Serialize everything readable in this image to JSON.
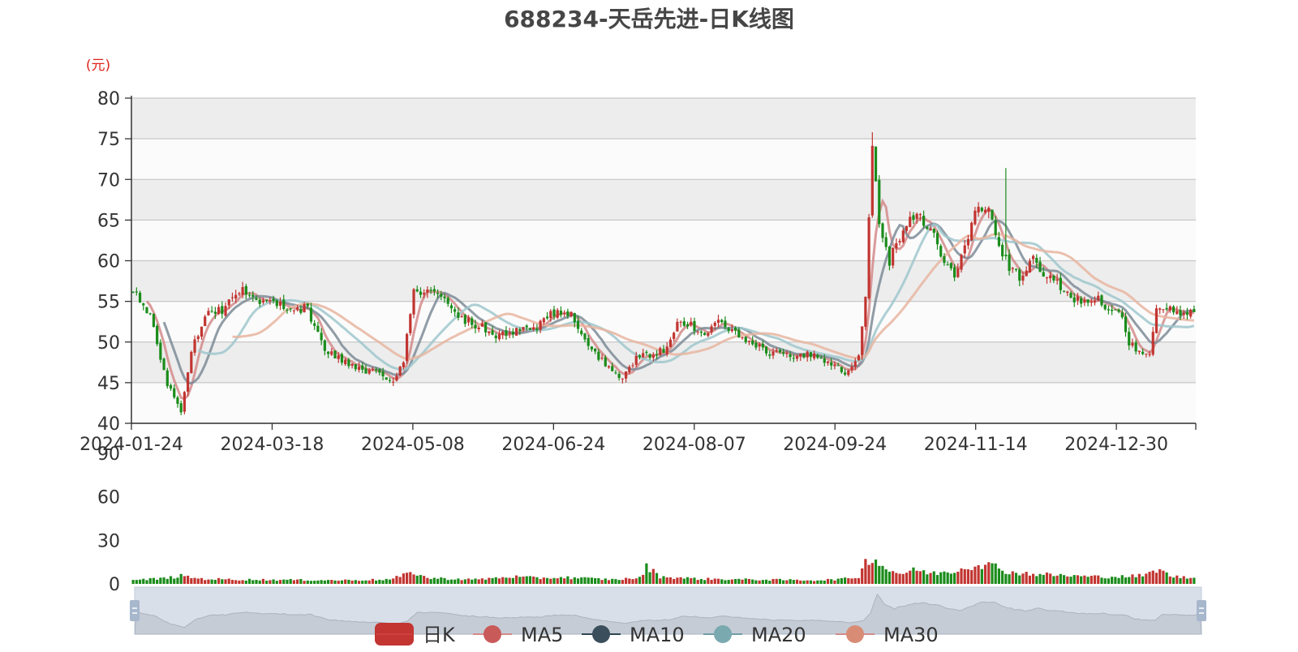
{
  "chart_data": {
    "type": "candlestick",
    "title": "688234-天岳先进-日K线图",
    "unit_label": "(元)",
    "y_ticks": [
      "40",
      "45",
      "50",
      "55",
      "60",
      "65",
      "70",
      "75",
      "80"
    ],
    "ylim": [
      40,
      80
    ],
    "x_tick_labels": [
      "2024-01-24",
      "2024-03-18",
      "2024-05-08",
      "2024-06-24",
      "2024-08-07",
      "2024-09-24",
      "2024-11-14",
      "2024-12-30"
    ],
    "volume_y_ticks": [
      "0",
      "30",
      "60",
      "90"
    ],
    "volume_ylim": [
      0,
      90
    ],
    "grid": true,
    "legend_position": "bottom",
    "legend": [
      "日K",
      "MA5",
      "MA10",
      "MA20",
      "MA30"
    ],
    "colors": {
      "up": "#c23531",
      "down": "#1b8c1b",
      "ma5": "#d48a8a",
      "ma10": "#7c8b96",
      "ma20": "#9fc7cc",
      "ma30": "#e8b5a0",
      "band_dark": "#ededed",
      "band_light": "#fbfbfb",
      "zoom_bg": "#d9dfe9",
      "zoom_handle": "#a7b7cc",
      "unit": "#e0241c"
    },
    "close_keypoints": [
      [
        0,
        56.5
      ],
      [
        5,
        53
      ],
      [
        10,
        45
      ],
      [
        14,
        41.5
      ],
      [
        17,
        49
      ],
      [
        21,
        53.5
      ],
      [
        26,
        54
      ],
      [
        31,
        56.5
      ],
      [
        37,
        55
      ],
      [
        44,
        54.5
      ],
      [
        51,
        54
      ],
      [
        56,
        49
      ],
      [
        60,
        48
      ],
      [
        67,
        46.5
      ],
      [
        72,
        46
      ],
      [
        76,
        45.5
      ],
      [
        79,
        48
      ],
      [
        82,
        56
      ],
      [
        86,
        56.5
      ],
      [
        91,
        55
      ],
      [
        96,
        53
      ],
      [
        101,
        52
      ],
      [
        106,
        51
      ],
      [
        113,
        51.5
      ],
      [
        118,
        52
      ],
      [
        124,
        54
      ],
      [
        128,
        53.5
      ],
      [
        133,
        49
      ],
      [
        138,
        47.5
      ],
      [
        143,
        45.5
      ],
      [
        147,
        48
      ],
      [
        152,
        48.5
      ],
      [
        156,
        49
      ],
      [
        159,
        53
      ],
      [
        163,
        52
      ],
      [
        168,
        51
      ],
      [
        171,
        52.5
      ],
      [
        174,
        51.5
      ],
      [
        179,
        50
      ],
      [
        184,
        49
      ],
      [
        189,
        48.5
      ],
      [
        194,
        48
      ],
      [
        199,
        48.5
      ],
      [
        204,
        47.5
      ],
      [
        208,
        46.5
      ],
      [
        212,
        48
      ],
      [
        214,
        56
      ],
      [
        216,
        74
      ],
      [
        218,
        65
      ],
      [
        221,
        60
      ],
      [
        225,
        64
      ],
      [
        229,
        66
      ],
      [
        233,
        64
      ],
      [
        237,
        60
      ],
      [
        240,
        58
      ],
      [
        244,
        63
      ],
      [
        247,
        67
      ],
      [
        250,
        66
      ],
      [
        253,
        62
      ],
      [
        256,
        59
      ],
      [
        259,
        58
      ],
      [
        263,
        60
      ],
      [
        267,
        58
      ],
      [
        271,
        57
      ],
      [
        276,
        55
      ],
      [
        281,
        55.5
      ],
      [
        286,
        54
      ],
      [
        289,
        53
      ],
      [
        291,
        50
      ],
      [
        295,
        48.5
      ],
      [
        297,
        48
      ],
      [
        299,
        54.5
      ],
      [
        302,
        54
      ],
      [
        306,
        53.5
      ],
      [
        310,
        53.5
      ]
    ],
    "volume_keypoints": [
      [
        0,
        2.5
      ],
      [
        10,
        4
      ],
      [
        14,
        5.5
      ],
      [
        20,
        3.5
      ],
      [
        30,
        3
      ],
      [
        60,
        2.5
      ],
      [
        75,
        3
      ],
      [
        82,
        8
      ],
      [
        86,
        4
      ],
      [
        100,
        3
      ],
      [
        111,
        5
      ],
      [
        118,
        4
      ],
      [
        126,
        4.5
      ],
      [
        140,
        3
      ],
      [
        148,
        4
      ],
      [
        150,
        12
      ],
      [
        154,
        5
      ],
      [
        165,
        3.5
      ],
      [
        180,
        3
      ],
      [
        200,
        2.5
      ],
      [
        208,
        3.5
      ],
      [
        212,
        5
      ],
      [
        214,
        15
      ],
      [
        216,
        19
      ],
      [
        220,
        10
      ],
      [
        225,
        7
      ],
      [
        229,
        10
      ],
      [
        233,
        7
      ],
      [
        240,
        9
      ],
      [
        247,
        14
      ],
      [
        252,
        12
      ],
      [
        256,
        8
      ],
      [
        262,
        7
      ],
      [
        270,
        6
      ],
      [
        280,
        5
      ],
      [
        290,
        5
      ],
      [
        296,
        6
      ],
      [
        299,
        10
      ],
      [
        304,
        5
      ],
      [
        310,
        4
      ]
    ],
    "trading_days": 311
  }
}
